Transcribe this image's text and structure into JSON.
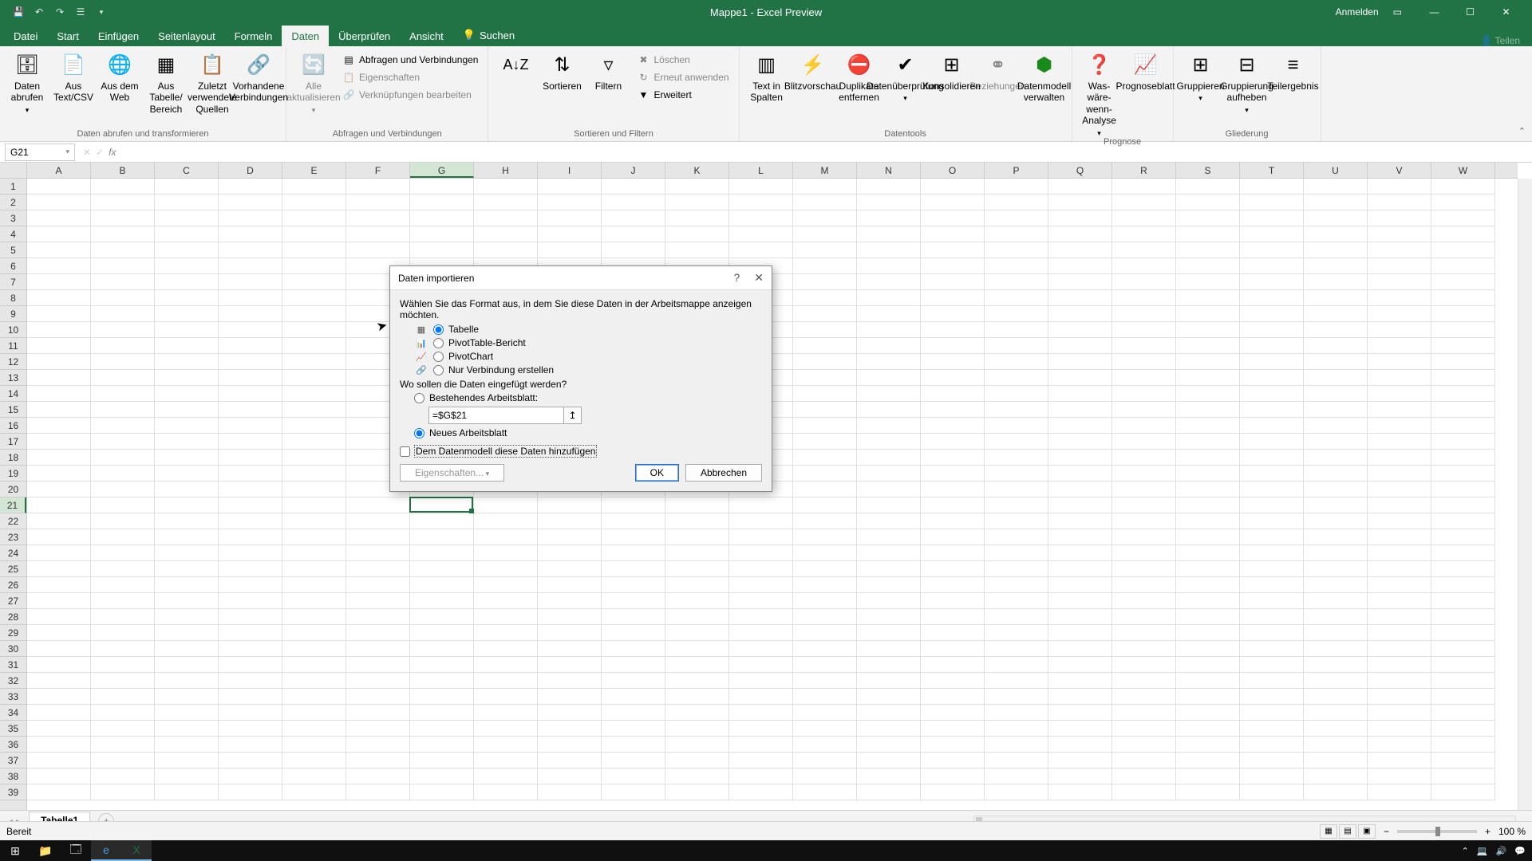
{
  "app": {
    "title": "Mappe1  -  Excel Preview",
    "signin": "Anmelden",
    "share": "Teilen"
  },
  "tabs": {
    "file": "Datei",
    "start": "Start",
    "insert": "Einfügen",
    "layout": "Seitenlayout",
    "formulas": "Formeln",
    "data": "Daten",
    "review": "Überprüfen",
    "view": "Ansicht",
    "search": "Suchen"
  },
  "ribbon": {
    "group1": {
      "label": "Daten abrufen und transformieren",
      "get_data": "Daten abrufen",
      "from_csv": "Aus Text/CSV",
      "from_web": "Aus dem Web",
      "from_table": "Aus Tabelle/ Bereich",
      "recent": "Zuletzt verwendete Quellen",
      "existing": "Vorhandene Verbindungen"
    },
    "group2": {
      "label": "Abfragen und Verbindungen",
      "refresh": "Alle aktualisieren",
      "queries": "Abfragen und Verbindungen",
      "props": "Eigenschaften",
      "links": "Verknüpfungen bearbeiten"
    },
    "group3": {
      "label": "Sortieren und Filtern",
      "sort": "Sortieren",
      "filter": "Filtern",
      "clear": "Löschen",
      "reapply": "Erneut anwenden",
      "advanced": "Erweitert"
    },
    "group4": {
      "label": "Datentools",
      "text_cols": "Text in Spalten",
      "flash": "Blitzvorschau",
      "dedup": "Duplikate entfernen",
      "validation": "Datenüberprüfung",
      "consolidate": "Konsolidieren",
      "relations": "Beziehungen",
      "model": "Datenmodell verwalten"
    },
    "group5": {
      "label": "Prognose",
      "whatif": "Was-wäre-wenn-Analyse",
      "forecast": "Prognoseblatt"
    },
    "group6": {
      "label": "Gliederung",
      "group": "Gruppieren",
      "ungroup": "Gruppierung aufheben",
      "subtotal": "Teilergebnis"
    }
  },
  "namebox": "G21",
  "columns": [
    "A",
    "B",
    "C",
    "D",
    "E",
    "F",
    "G",
    "H",
    "I",
    "J",
    "K",
    "L",
    "M",
    "N",
    "O",
    "P",
    "Q",
    "R",
    "S",
    "T",
    "U",
    "V",
    "W"
  ],
  "active_col": "G",
  "active_row": 21,
  "row_count": 39,
  "sheet": {
    "tab1": "Tabelle1"
  },
  "status": {
    "ready": "Bereit",
    "zoom": "100 %"
  },
  "dialog": {
    "title": "Daten importieren",
    "prompt": "Wählen Sie das Format aus, in dem Sie diese Daten in der Arbeitsmappe anzeigen möchten.",
    "opt_table": "Tabelle",
    "opt_pivot": "PivotTable-Bericht",
    "opt_chart": "PivotChart",
    "opt_conn": "Nur Verbindung erstellen",
    "where": "Wo sollen die Daten eingefügt werden?",
    "existing": "Bestehendes Arbeitsblatt:",
    "ref": "=$G$21",
    "new_sheet": "Neues Arbeitsblatt",
    "add_model": "Dem Datenmodell diese Daten hinzufügen",
    "props": "Eigenschaften...",
    "ok": "OK",
    "cancel": "Abbrechen"
  }
}
